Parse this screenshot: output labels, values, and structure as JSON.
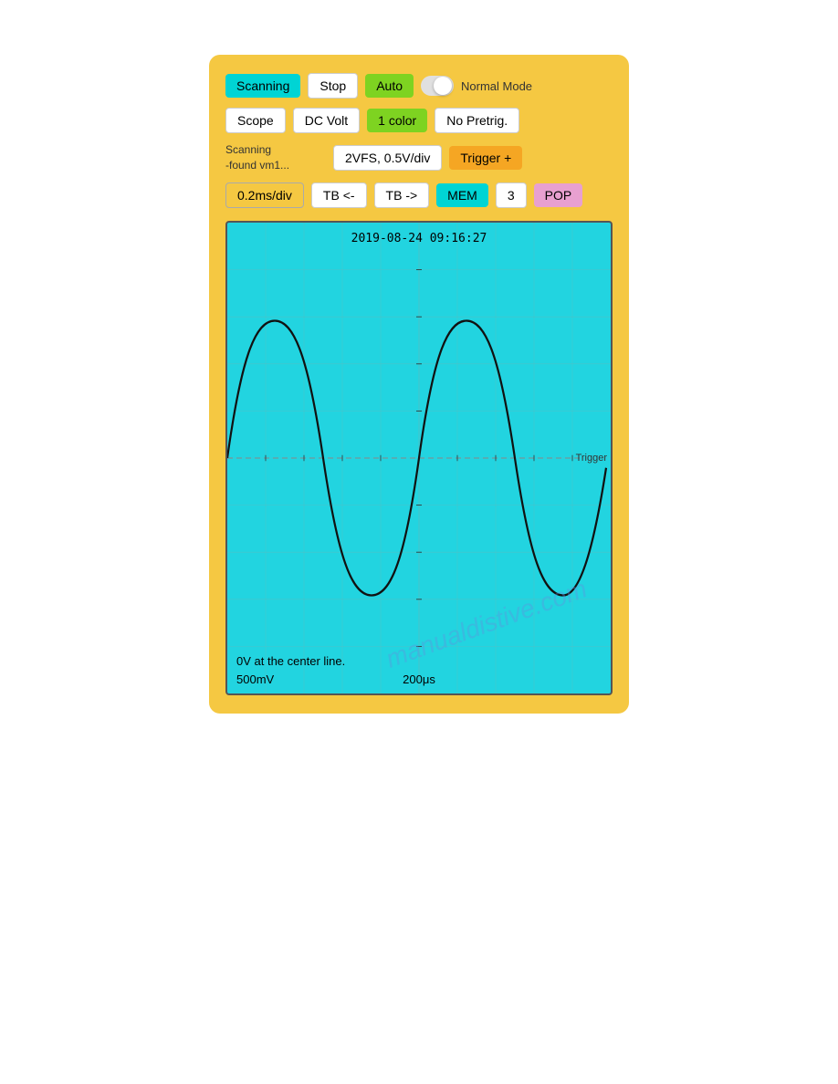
{
  "panel": {
    "background_color": "#f5c842"
  },
  "row1": {
    "scanning_label": "Scanning",
    "stop_label": "Stop",
    "auto_label": "Auto",
    "mode_label": "Normal Mode"
  },
  "row2": {
    "scope_label": "Scope",
    "dc_volt_label": "DC Volt",
    "color_label": "1 color",
    "pretrig_label": "No Pretrig."
  },
  "row3": {
    "scan_status": "Scanning\n-found vm1...",
    "vfs_label": "2VFS, 0.5V/div",
    "trigger_label": "Trigger +"
  },
  "row4": {
    "timebase_label": "0.2ms/div",
    "tb_left_label": "TB <-",
    "tb_right_label": "TB ->",
    "mem_label": "MEM",
    "num_label": "3",
    "pop_label": "POP"
  },
  "scope": {
    "timestamp": "2019-08-24 09:16:27",
    "trigger_marker": "Trigger",
    "bottom_text": "0V at the center line.",
    "volt_label": "500mV",
    "time_label": "200μs",
    "watermark": "manualdistive.com"
  }
}
